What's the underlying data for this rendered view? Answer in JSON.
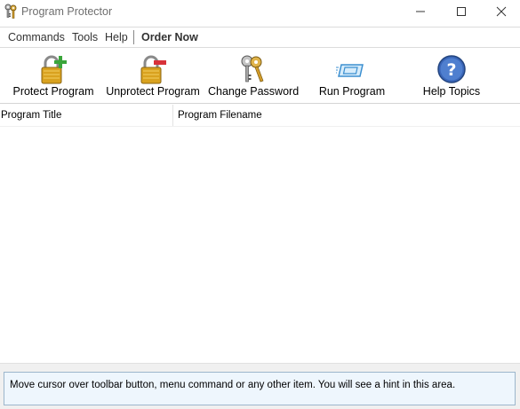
{
  "window": {
    "title": "Program Protector",
    "icon": "keys-icon",
    "controls": [
      "minimize-icon",
      "maximize-icon",
      "close-icon"
    ]
  },
  "menu": {
    "items": [
      "Commands",
      "Tools",
      "Help"
    ],
    "order_now": "Order Now"
  },
  "toolbar": {
    "buttons": [
      {
        "label": "Protect Program",
        "icon": "lock-add-icon"
      },
      {
        "label": "Unprotect Program",
        "icon": "lock-remove-icon"
      },
      {
        "label": "Change Password",
        "icon": "keys-icon"
      },
      {
        "label": "Run Program",
        "icon": "run-window-icon"
      },
      {
        "label": "Help Topics",
        "icon": "help-icon"
      }
    ]
  },
  "list": {
    "columns": [
      "Program Title",
      "Program Filename"
    ],
    "rows": []
  },
  "hint": {
    "text": "Move cursor over toolbar button, menu command or any other item. You will see a hint in this area."
  },
  "colors": {
    "hint_background": "#eef6fd",
    "hint_border": "#9cb6cc",
    "lock_gold": "#d9a21f",
    "add_green": "#3aa53a",
    "remove_red": "#d8323a",
    "help_blue": "#3a66b8"
  }
}
